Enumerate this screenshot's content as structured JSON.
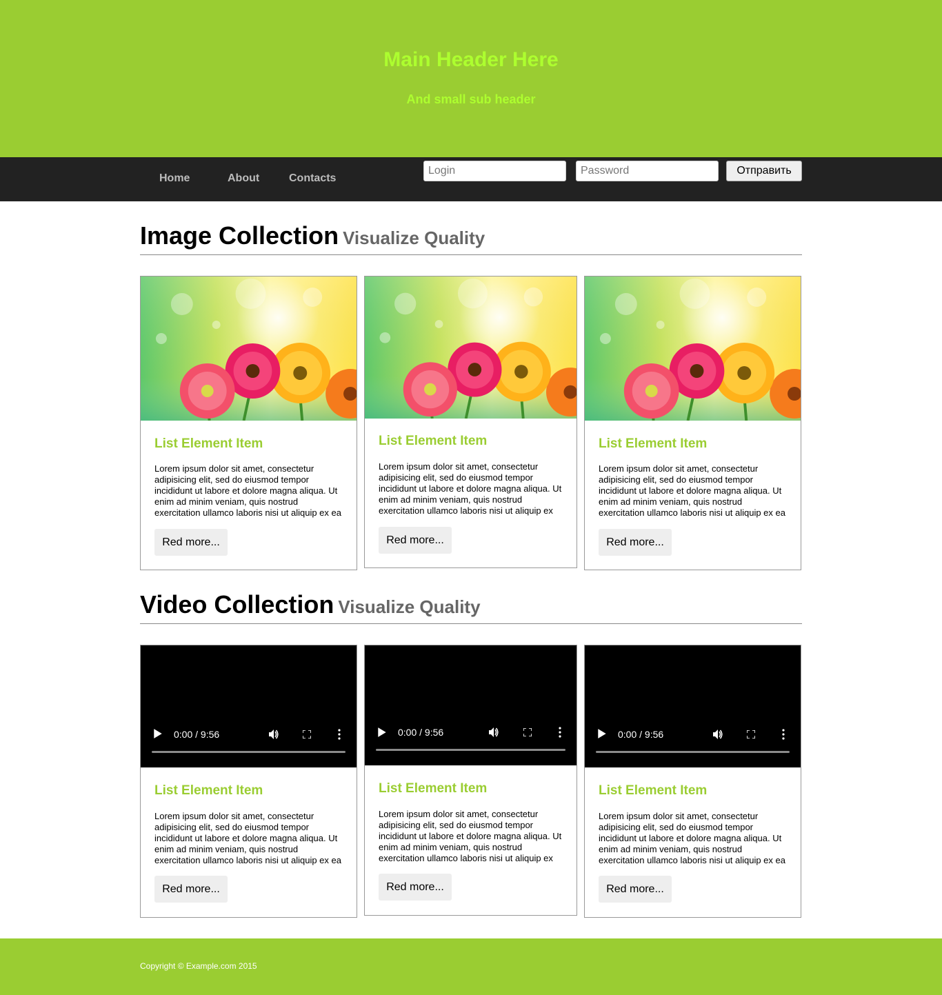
{
  "header": {
    "title": "Main Header Here",
    "subtitle": "And small sub header",
    "bg_color": "#9acd32",
    "text_color": "#adff2f"
  },
  "nav": {
    "links": [
      "Home",
      "About",
      "Contacts"
    ],
    "login_placeholder": "Login",
    "password_placeholder": "Password",
    "submit_label": "Отправить"
  },
  "images_section": {
    "title": "Image Collection",
    "subtitle": "Visualize Quality",
    "cards": [
      {
        "title": "List Element Item",
        "text": "Lorem ipsum dolor sit amet, consectetur adipisicing elit, sed do eiusmod tempor incididunt ut labore et dolore magna aliqua. Ut enim ad minim veniam, quis nostrud exercitation ullamco laboris nisi ut aliquip ex ea",
        "button": "Red more..."
      },
      {
        "title": "List Element Item",
        "text": "Lorem ipsum dolor sit amet, consectetur adipisicing elit, sed do eiusmod tempor incididunt ut labore et dolore magna aliqua. Ut enim ad minim veniam, quis nostrud exercitation ullamco laboris nisi ut aliquip ex",
        "button": "Red more..."
      },
      {
        "title": "List Element Item",
        "text": "Lorem ipsum dolor sit amet, consectetur adipisicing elit, sed do eiusmod tempor incididunt ut labore et dolore magna aliqua. Ut enim ad minim veniam, quis nostrud exercitation ullamco laboris nisi ut aliquip ex ea",
        "button": "Red more..."
      }
    ]
  },
  "videos_section": {
    "title": "Video Collection",
    "subtitle": "Visualize Quality",
    "cards": [
      {
        "title": "List Element Item",
        "time": "0:00 / 9:56",
        "text": "Lorem ipsum dolor sit amet, consectetur adipisicing elit, sed do eiusmod tempor incididunt ut labore et dolore magna aliqua. Ut enim ad minim veniam, quis nostrud exercitation ullamco laboris nisi ut aliquip ex ea",
        "button": "Red more..."
      },
      {
        "title": "List Element Item",
        "time": "0:00 / 9:56",
        "text": "Lorem ipsum dolor sit amet, consectetur adipisicing elit, sed do eiusmod tempor incididunt ut labore et dolore magna aliqua. Ut enim ad minim veniam, quis nostrud exercitation ullamco laboris nisi ut aliquip ex",
        "button": "Red more..."
      },
      {
        "title": "List Element Item",
        "time": "0:00 / 9:56",
        "text": "Lorem ipsum dolor sit amet, consectetur adipisicing elit, sed do eiusmod tempor incididunt ut labore et dolore magna aliqua. Ut enim ad minim veniam, quis nostrud exercitation ullamco laboris nisi ut aliquip ex ea",
        "button": "Red more..."
      }
    ]
  },
  "footer": {
    "copyright": "Copyright © Example.com 2015"
  }
}
